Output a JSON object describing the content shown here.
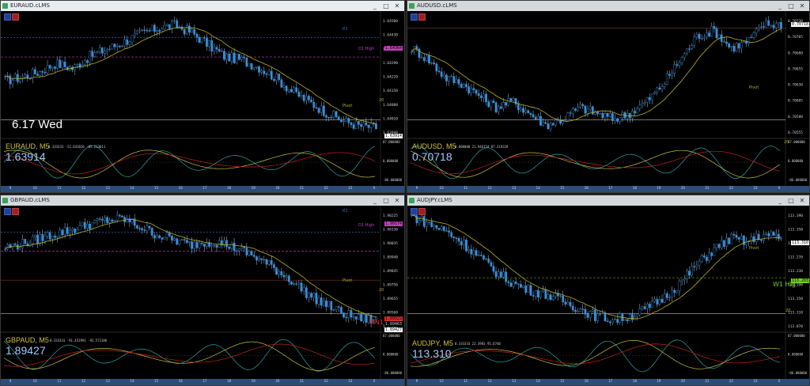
{
  "colors": {
    "bull": "#3b8fd9",
    "bear": "#3b8fd9",
    "ma_yellow": "#b8b02a",
    "osc_yellow": "#c8c040",
    "osc_teal": "#2aa3a3",
    "osc_red": "#c02020",
    "r1": "#3b6fd0",
    "pivot": "#b8b02a",
    "d1high": "#c040c0",
    "w1high": "#70d020",
    "mn1": "#d03030",
    "big_text": "#ffffff",
    "price_label": "#a0c8ff",
    "symbol_label": "#d0c040"
  },
  "windows": [
    {
      "title": "EURAUD.cLMS",
      "symbol_label": "EURAUD, M5",
      "price": "1.63914",
      "date_label": "6.17 Wed",
      "osc_values": "0.333333 -52.641036 -85.213011",
      "ylabels": [
        "1.64500",
        "1.64430",
        "1.64360",
        "1.64290",
        "1.64220",
        "1.64150",
        "1.64080",
        "1.64010",
        "1.63940"
      ],
      "price_box": "1.63914",
      "level_box": "1.64364",
      "r1": "R1",
      "d1high": "D1 High",
      "pivot": "Pivot",
      "yr": "20",
      "osc_ylabels": [
        "87.000000",
        "0.000000",
        "-86.000000"
      ],
      "time_ticks": [
        "9",
        "10",
        "11",
        "12",
        "13",
        "14",
        "15",
        "16",
        "17",
        "18",
        "19",
        "20",
        "21",
        "22",
        "23",
        "0"
      ],
      "close_values": [
        1.6418,
        1.642,
        1.6423,
        1.6428,
        1.6425,
        1.6432,
        1.6436,
        1.644,
        1.6445,
        1.6448,
        1.645,
        1.6446,
        1.6439,
        1.6432,
        1.643,
        1.6426,
        1.642,
        1.6412,
        1.6406,
        1.64,
        1.6395,
        1.6392,
        1.6391
      ]
    },
    {
      "title": "AUDUSD.cLMS",
      "symbol_label": "AUDUSD, M5",
      "price": "0.70718",
      "osc_values": "0.000000 21.946154 87.219329",
      "ylabels": [
        "0.70730",
        "0.70705",
        "0.70680",
        "0.70655",
        "0.70630",
        "0.70605",
        "0.70580",
        "0.70555"
      ],
      "price_box": "0.70718",
      "pivot": "Pivot",
      "yr": "20",
      "osc_ylabels": [
        "87.000000",
        "0.000000",
        "-86.000000"
      ],
      "time_ticks": [
        "9",
        "10",
        "11",
        "12",
        "13",
        "14",
        "15",
        "16",
        "17",
        "18",
        "19",
        "20",
        "21",
        "22",
        "23",
        "0"
      ],
      "close_values": [
        0.7068,
        0.7066,
        0.7063,
        0.7062,
        0.706,
        0.7058,
        0.7059,
        0.7057,
        0.7055,
        0.7056,
        0.7058,
        0.7057,
        0.7056,
        0.7057,
        0.7059,
        0.7062,
        0.7066,
        0.707,
        0.7071,
        0.7068,
        0.7069,
        0.7072,
        0.7072
      ]
    },
    {
      "title": "GBPAUD.cLMS",
      "symbol_label": "GBPAUD, M5",
      "price": "1.89427",
      "osc_values": "0.333333 -91.452991 -92.572186",
      "ylabels": [
        "1.90225",
        "1.90130",
        "1.90035",
        "1.89940",
        "1.89845",
        "1.89750",
        "1.89655",
        "1.89560",
        "1.89465"
      ],
      "price_box": "1.89427",
      "level_box": "1.90174",
      "level_box2": "1.89463",
      "mn1_box": "1.89522",
      "r1": "R1",
      "d1high": "D1 High",
      "pivot": "Pivot",
      "mn1": "MN1",
      "yr": "20",
      "osc_ylabels": [
        "87.000000",
        "0.000000",
        "-86.000000"
      ],
      "time_ticks": [
        "9",
        "10",
        "11",
        "12",
        "13",
        "14",
        "15",
        "16",
        "17",
        "18",
        "19",
        "20",
        "21",
        "22",
        "23",
        "0"
      ],
      "close_values": [
        1.8998,
        1.9001,
        1.9005,
        1.9009,
        1.9012,
        1.9016,
        1.9019,
        1.902,
        1.9014,
        1.9008,
        1.9004,
        1.9,
        1.9003,
        1.9001,
        1.8996,
        1.899,
        1.8982,
        1.8973,
        1.8962,
        1.8955,
        1.8948,
        1.8944,
        1.8943
      ]
    },
    {
      "title": "AUDJPY.cLMS",
      "symbol_label": "AUDJPY, M5",
      "price": "113.310",
      "osc_values": "0.333333 22.3983 95.6740",
      "ylabels": [
        "113.390",
        "113.350",
        "113.310",
        "113.270",
        "113.230",
        "113.190",
        "113.150",
        "113.110",
        "113.070"
      ],
      "price_box": "113.310",
      "level_box": "113.203",
      "pivot": "Pivot",
      "w1high": "W1 Hig",
      "yr": "20",
      "osc_ylabels": [
        "87.000000",
        "0.000000",
        "-86.000000"
      ],
      "time_ticks": [
        "9",
        "10",
        "11",
        "12",
        "13",
        "14",
        "15",
        "16",
        "17",
        "18",
        "19",
        "20",
        "21",
        "22",
        "23",
        "0"
      ],
      "close_values": [
        113.37,
        113.35,
        113.33,
        113.3,
        113.26,
        113.22,
        113.19,
        113.17,
        113.16,
        113.14,
        113.12,
        113.1,
        113.09,
        113.1,
        113.12,
        113.15,
        113.19,
        113.24,
        113.28,
        113.31,
        113.3,
        113.32,
        113.31
      ]
    }
  ]
}
